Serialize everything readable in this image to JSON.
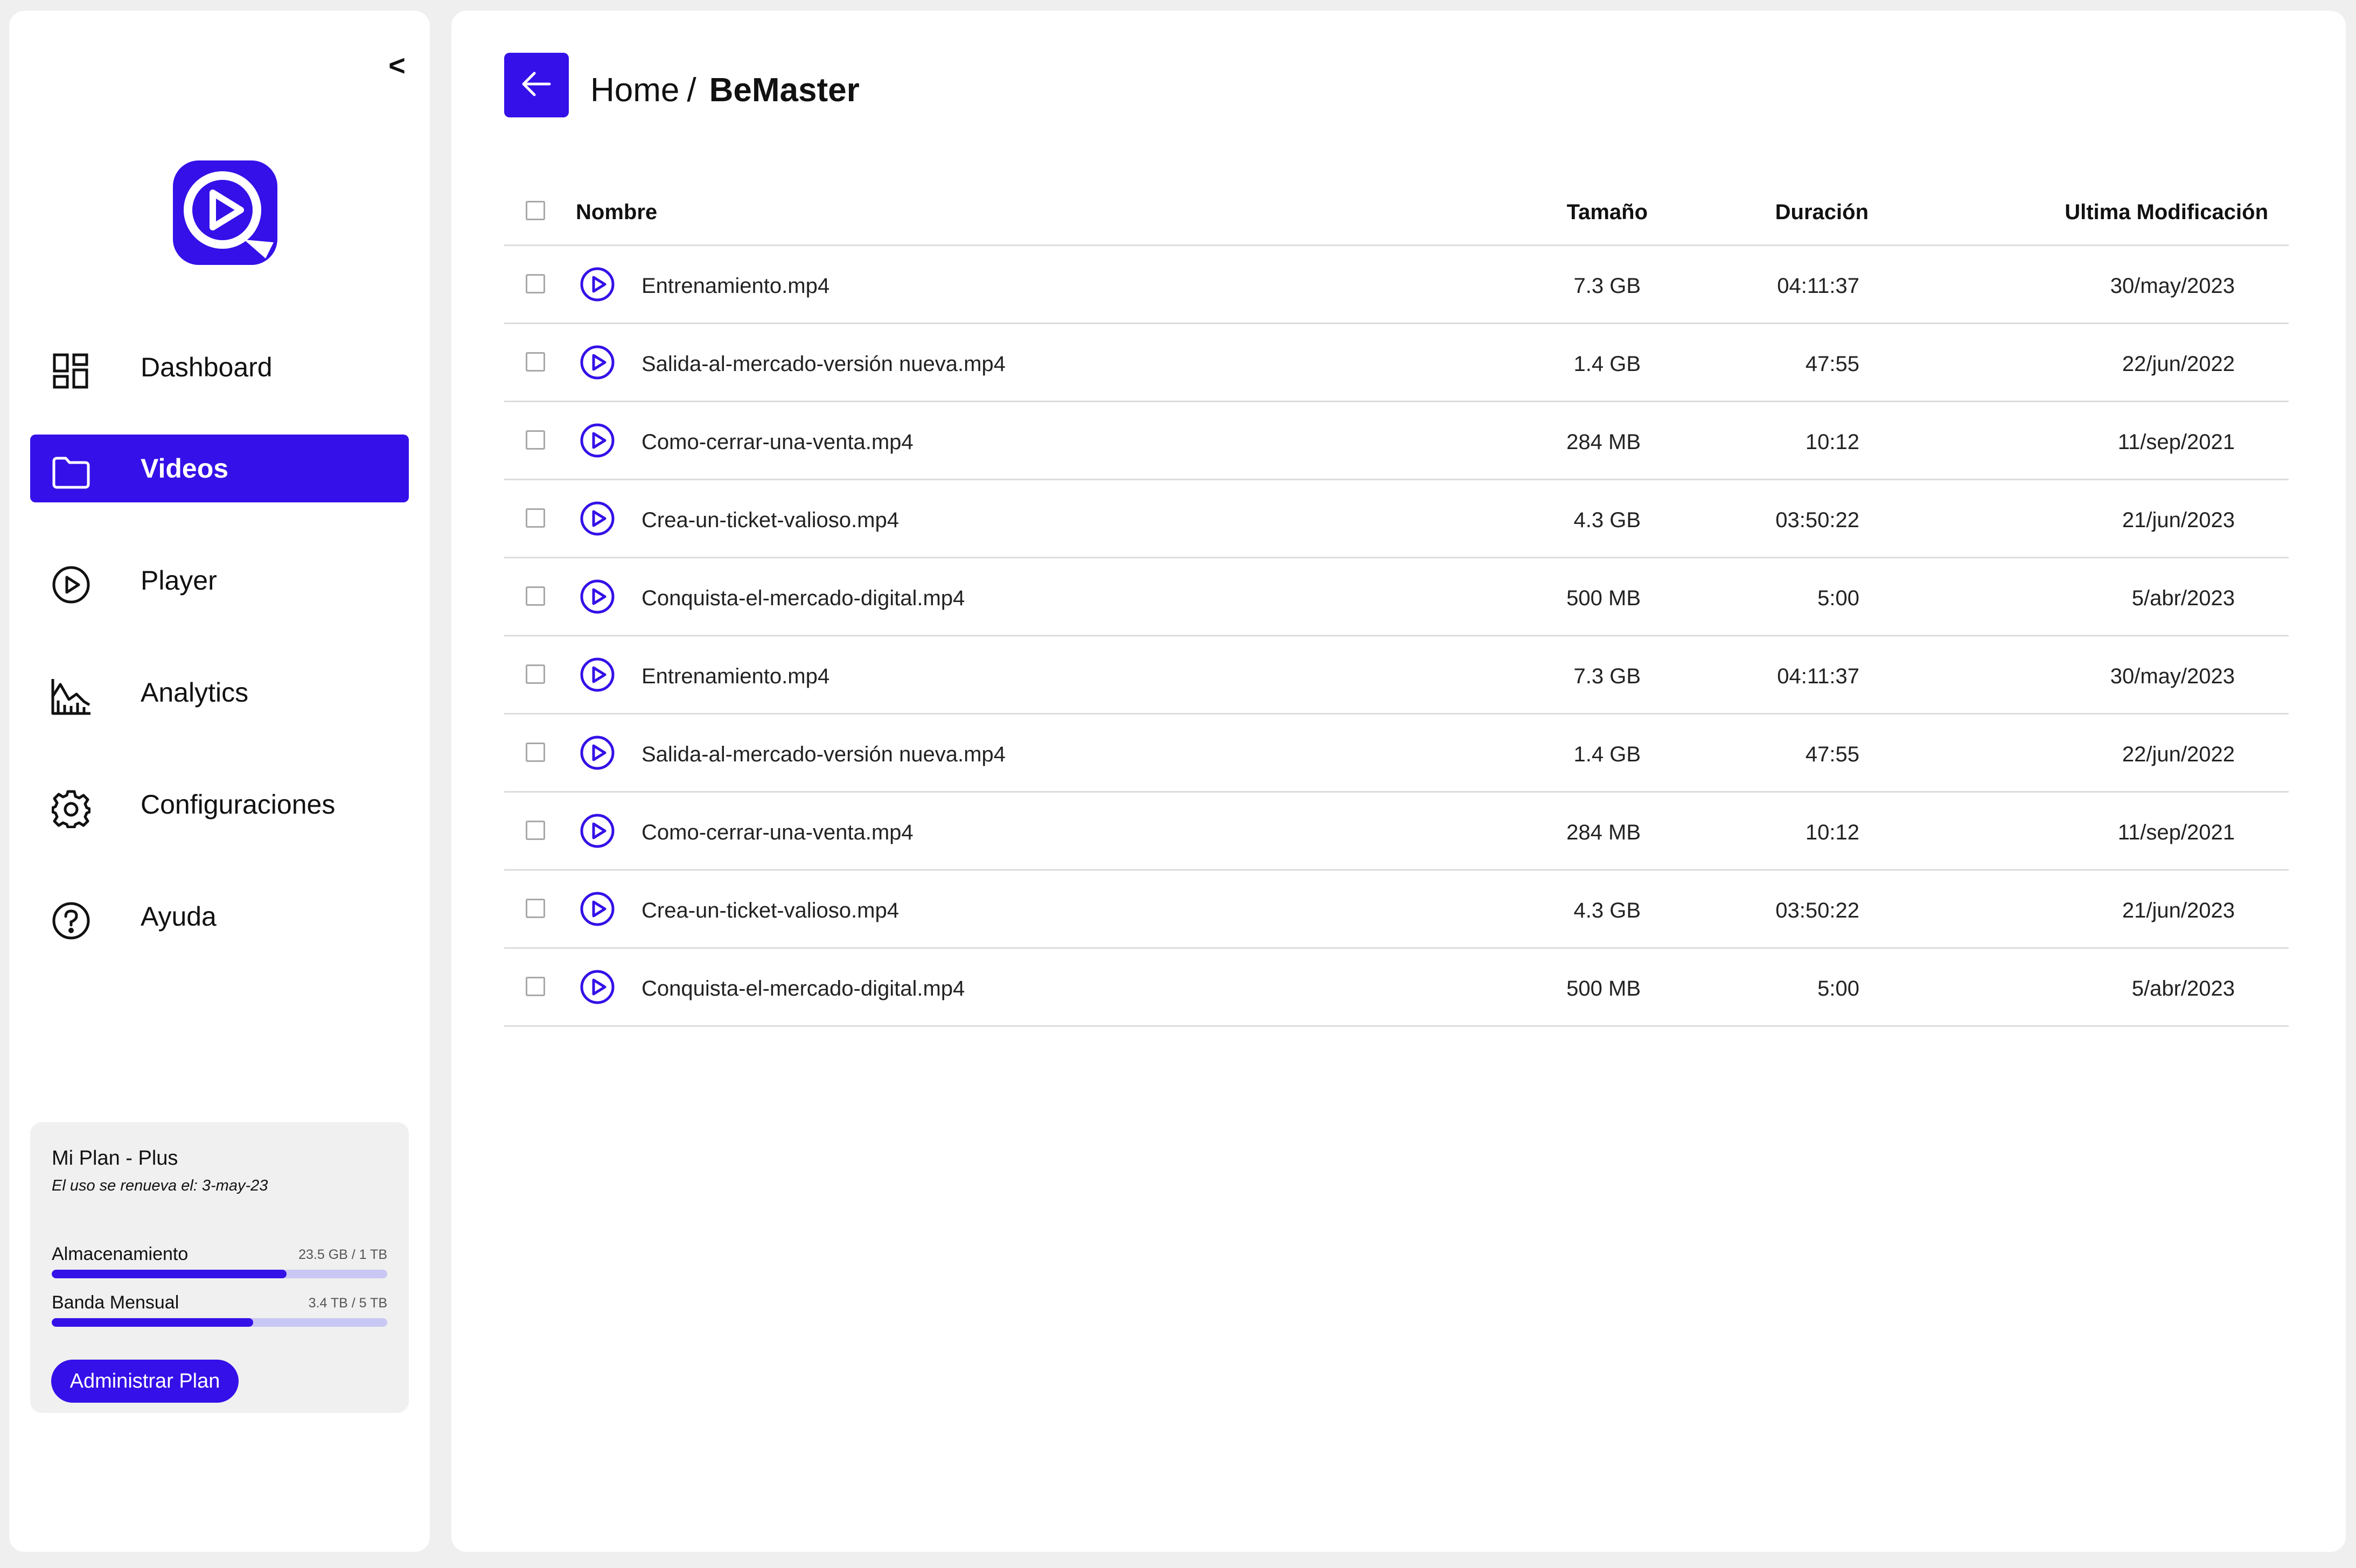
{
  "sidebar": {
    "collapse_label": "<",
    "logo_icon": "play-circle-logo",
    "nav": [
      {
        "label": "Dashboard",
        "icon": "dashboard-grid-icon"
      },
      {
        "label": "Videos",
        "icon": "folder-icon",
        "active": true
      },
      {
        "label": "Player",
        "icon": "play-circle-icon"
      },
      {
        "label": "Analytics",
        "icon": "chart-icon"
      },
      {
        "label": "Configuraciones",
        "icon": "gear-icon"
      },
      {
        "label": "Ayuda",
        "icon": "help-icon"
      }
    ],
    "plan": {
      "title": "Mi Plan - Plus",
      "renew": "El uso se renueva el: 3-may-23",
      "storage_label": "Almacenamiento",
      "storage_value": "23.5 GB / 1 TB",
      "storage_fraction": 0.7,
      "bandwidth_label": "Banda Mensual",
      "bandwidth_value": "3.4 TB / 5 TB",
      "bandwidth_fraction": 0.6,
      "button": "Administrar Plan"
    }
  },
  "header": {
    "back_icon": "arrow-left-icon",
    "crumb_home": "Home",
    "crumb_sep": "/",
    "crumb_current": "BeMaster"
  },
  "table": {
    "columns": {
      "name": "Nombre",
      "size": "Tamaño",
      "duration": "Duración",
      "modified": "Ultima Modificación"
    },
    "rows": [
      {
        "name": "Entrenamiento.mp4",
        "size": "7.3 GB",
        "duration": "04:11:37",
        "modified": "30/may/2023"
      },
      {
        "name": "Salida-al-mercado-versión nueva.mp4",
        "size": "1.4 GB",
        "duration": "47:55",
        "modified": "22/jun/2022"
      },
      {
        "name": "Como-cerrar-una-venta.mp4",
        "size": "284 MB",
        "duration": "10:12",
        "modified": "11/sep/2021"
      },
      {
        "name": "Crea-un-ticket-valioso.mp4",
        "size": "4.3 GB",
        "duration": "03:50:22",
        "modified": "21/jun/2023"
      },
      {
        "name": "Conquista-el-mercado-digital.mp4",
        "size": "500 MB",
        "duration": "5:00",
        "modified": "5/abr/2023"
      },
      {
        "name": "Entrenamiento.mp4",
        "size": "7.3 GB",
        "duration": "04:11:37",
        "modified": "30/may/2023"
      },
      {
        "name": "Salida-al-mercado-versión nueva.mp4",
        "size": "1.4 GB",
        "duration": "47:55",
        "modified": "22/jun/2022"
      },
      {
        "name": "Como-cerrar-una-venta.mp4",
        "size": "284 MB",
        "duration": "10:12",
        "modified": "11/sep/2021"
      },
      {
        "name": "Crea-un-ticket-valioso.mp4",
        "size": "4.3 GB",
        "duration": "03:50:22",
        "modified": "21/jun/2023"
      },
      {
        "name": "Conquista-el-mercado-digital.mp4",
        "size": "500 MB",
        "duration": "5:00",
        "modified": "5/abr/2023"
      }
    ]
  },
  "colors": {
    "accent": "#3510e8",
    "accent_light": "#c9c8f4",
    "page_bg": "#efefef"
  }
}
